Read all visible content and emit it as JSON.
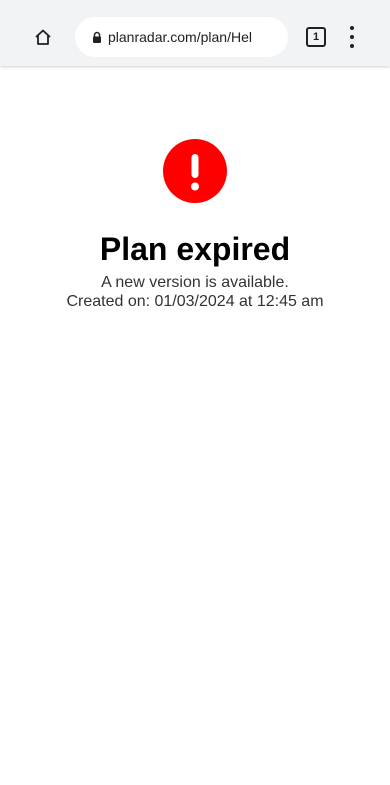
{
  "browser": {
    "url": "planradar.com/plan/Hel",
    "tab_count": "1",
    "icons": {
      "home": "home-icon",
      "lock": "lock-icon",
      "tabs": "tabs-icon",
      "menu": "more-vert-icon"
    }
  },
  "page": {
    "alert_icon": "exclamation-icon",
    "alert_color": "#ff0000",
    "title": "Plan expired",
    "message": "A new version is available.",
    "created": "Created on: 01/03/2024 at 12:45 am"
  }
}
